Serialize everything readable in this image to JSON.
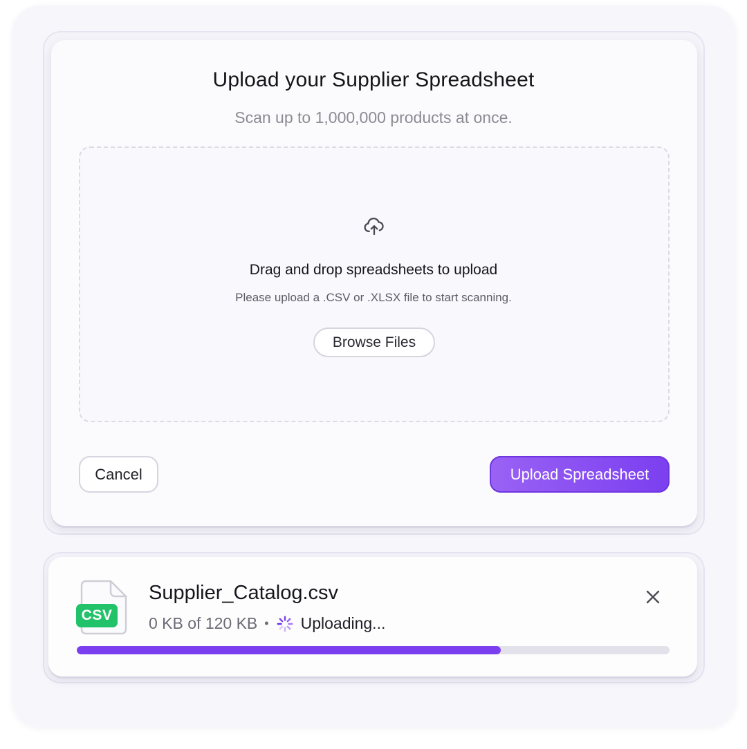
{
  "dialog": {
    "title": "Upload your Supplier Spreadsheet",
    "subtitle": "Scan up to 1,000,000 products at once."
  },
  "dropzone": {
    "icon": "cloud-upload-icon",
    "heading": "Drag and drop spreadsheets to upload",
    "subtext": "Please upload a .CSV or .XLSX file to start scanning.",
    "browse_label": "Browse Files"
  },
  "actions": {
    "cancel_label": "Cancel",
    "upload_label": "Upload Spreadsheet"
  },
  "file": {
    "icon": "file-icon",
    "badge": "CSV",
    "name": "Supplier_Catalog.csv",
    "size_progress": "0 KB of 120 KB",
    "separator": "•",
    "status": "Uploading...",
    "status_icon": "spinner-icon",
    "close_icon": "close-icon",
    "progress": 0.715
  },
  "colors": {
    "accent": "#7b3ff0",
    "badge_green": "#22c26b",
    "track": "#e3e2ea"
  }
}
